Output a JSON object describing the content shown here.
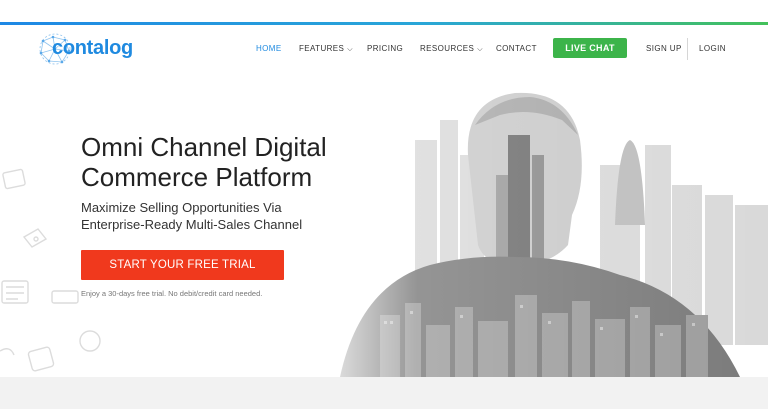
{
  "brand": {
    "name": "contalog",
    "color": "#1f8ae0"
  },
  "nav": {
    "home": "HOME",
    "features": "FEATURES",
    "pricing": "PRICING",
    "resources": "RESOURCES",
    "contact": "CONTACT",
    "live_chat": "LIVE CHAT",
    "sign_up": "SIGN UP",
    "login": "LOGIN",
    "dropdown_icon": "chevron-down-icon"
  },
  "hero": {
    "title_line1": "Omni Channel Digital",
    "title_line2": "Commerce Platform",
    "subtitle_line1": "Maximize Selling Opportunities Via",
    "subtitle_line2": "Enterprise-Ready Multi-Sales Channel",
    "cta_label": "START YOUR FREE TRIAL",
    "note": "Enjoy a 30-days free trial. No debit/credit card needed."
  },
  "colors": {
    "accent_blue": "#1f8ae0",
    "live_chat_green": "#3cb44a",
    "cta_red": "#f0391d"
  }
}
